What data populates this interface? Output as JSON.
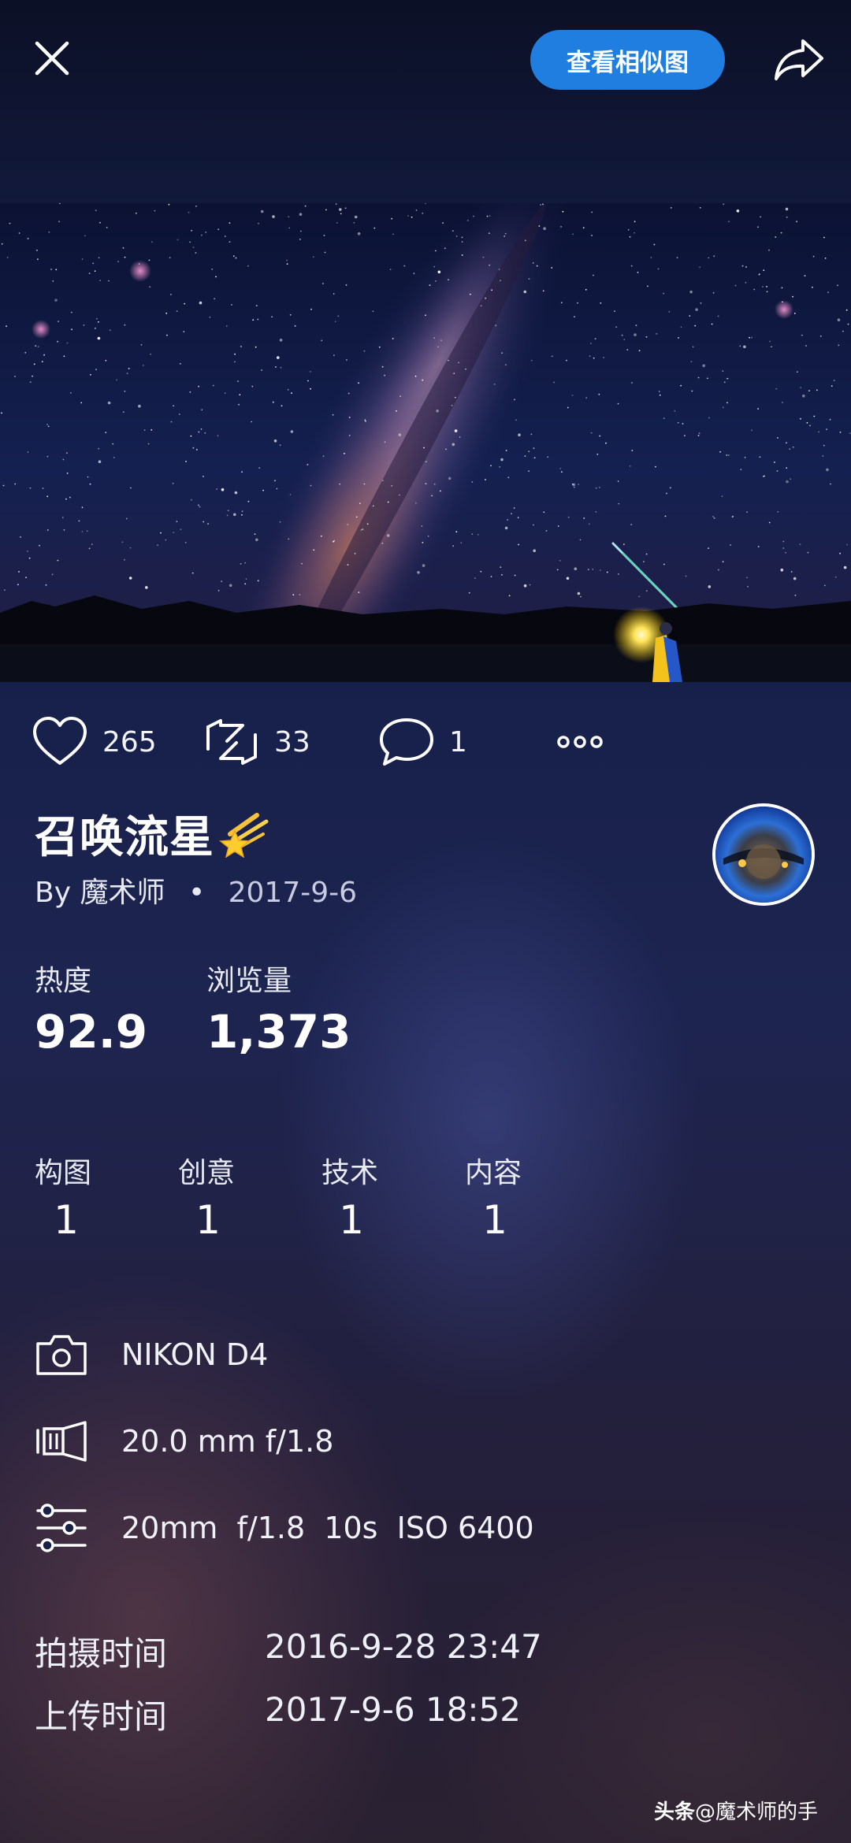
{
  "topbar": {
    "similar_button": "查看相似图"
  },
  "actions": {
    "likes": "265",
    "reposts": "33",
    "comments": "1"
  },
  "post": {
    "title": "召唤流星",
    "byline_prefix": "By",
    "author": "魔术师",
    "separator": "•",
    "date": "2017-9-6"
  },
  "stats": {
    "heat_label": "热度",
    "heat_value": "92.9",
    "views_label": "浏览量",
    "views_value": "1,373"
  },
  "scores": [
    {
      "label": "构图",
      "value": "1"
    },
    {
      "label": "创意",
      "value": "1"
    },
    {
      "label": "技术",
      "value": "1"
    },
    {
      "label": "内容",
      "value": "1"
    }
  ],
  "exif": {
    "camera": "NIKON D4",
    "lens": "20.0 mm f/1.8",
    "settings": "20mm  f/1.8  10s  ISO 6400"
  },
  "times": {
    "shot_label": "拍摄时间",
    "shot_value": "2016-9-28 23:47",
    "upload_label": "上传时间",
    "upload_value": "2017-9-6 18:52"
  },
  "watermark": {
    "brand": "头条",
    "handle": "@魔术师的手"
  },
  "colors": {
    "accent": "#1f7ee0",
    "background_top": "#0c1026",
    "background_bottom": "#2a2131"
  },
  "icons": [
    "close-icon",
    "share-icon",
    "heart-icon",
    "repost-icon",
    "comment-icon",
    "more-icon",
    "camera-icon",
    "lens-icon",
    "settings-sliders-icon",
    "meteor-emoji-icon"
  ]
}
